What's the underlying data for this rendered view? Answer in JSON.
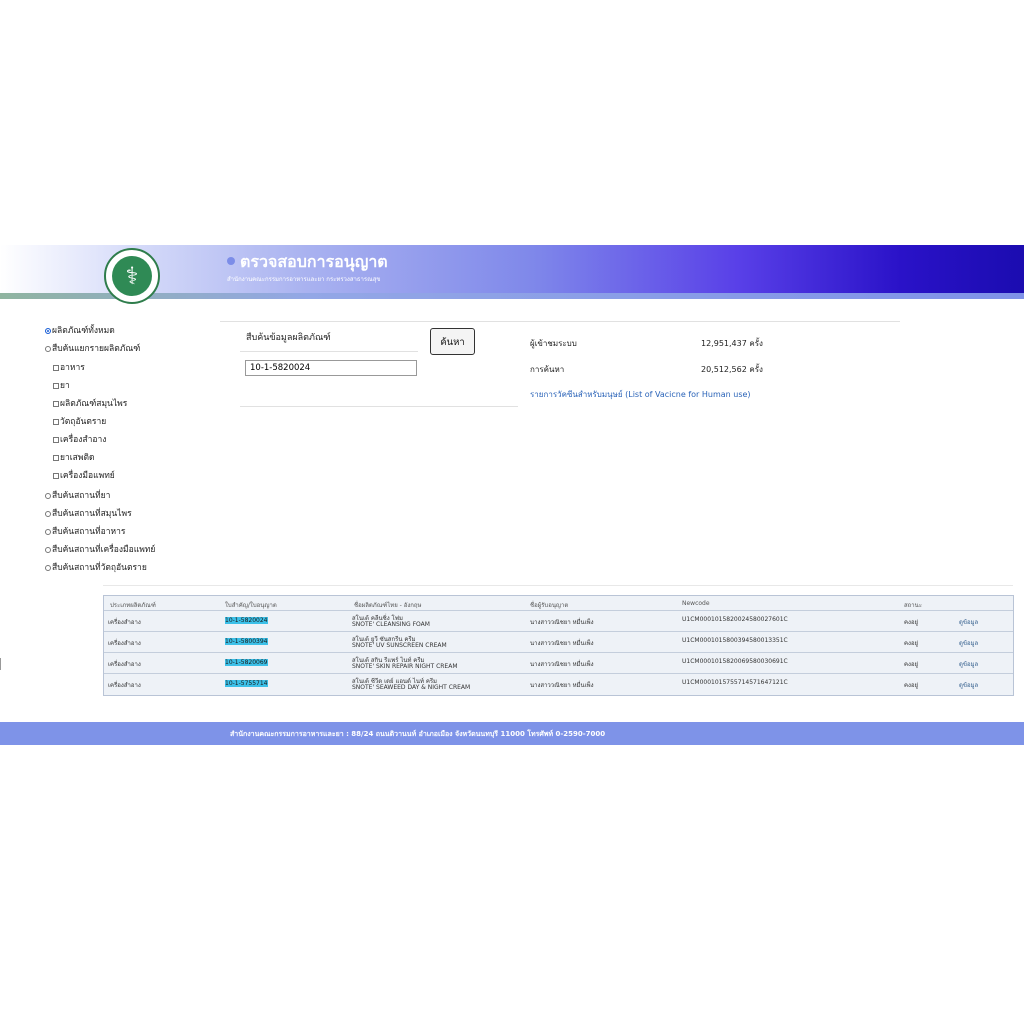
{
  "header": {
    "title": "ตรวจสอบการอนุญาต",
    "subtitle": "สำนักงานคณะกรรมการอาหารและยา กระทรวงสาธารณสุข"
  },
  "sidebar": {
    "items": [
      {
        "label": "ผลิตภัณฑ์ทั้งหมด",
        "type": "radio",
        "checked": true
      },
      {
        "label": "สืบค้นแยกรายผลิตภัณฑ์",
        "type": "radio",
        "checked": false
      },
      {
        "label": "อาหาร",
        "type": "checkbox",
        "checked": false
      },
      {
        "label": "ยา",
        "type": "checkbox",
        "checked": false
      },
      {
        "label": "ผลิตภัณฑ์สมุนไพร",
        "type": "checkbox",
        "checked": false
      },
      {
        "label": "วัตถุอันตราย",
        "type": "checkbox",
        "checked": false
      },
      {
        "label": "เครื่องสำอาง",
        "type": "checkbox",
        "checked": false
      },
      {
        "label": "ยาเสพติด",
        "type": "checkbox",
        "checked": false
      },
      {
        "label": "เครื่องมือแพทย์",
        "type": "checkbox",
        "checked": false
      },
      {
        "label": "สืบค้นสถานที่ยา",
        "type": "radio",
        "checked": false
      },
      {
        "label": "สืบค้นสถานที่สมุนไพร",
        "type": "radio",
        "checked": false
      },
      {
        "label": "สืบค้นสถานที่อาหาร",
        "type": "radio",
        "checked": false
      },
      {
        "label": "สืบค้นสถานที่เครื่องมือแพทย์",
        "type": "radio",
        "checked": false
      },
      {
        "label": "สืบค้นสถานที่วัตถุอันตราย",
        "type": "radio",
        "checked": false
      }
    ]
  },
  "search": {
    "label": "สืบค้นข้อมูลผลิตภัณฑ์",
    "value": "10-1-5820024",
    "button_label": "ค้นหา"
  },
  "stats": {
    "visitors_label": "ผู้เข้าชมระบบ",
    "visitors_value": "12,951,437 ครั้ง",
    "searches_label": "การค้นหา",
    "searches_value": "20,512,562 ครั้ง",
    "vaccine_link": "รายการวัคซีนสำหรับมนุษย์ (List of Vacicne for Human use)"
  },
  "table": {
    "headers": [
      "ประเภทผลิตภัณฑ์",
      "ใบสำคัญ/ใบอนุญาต",
      "ชื่อผลิตภัณฑ์ไทย - อังกฤษ",
      "ชื่อผู้รับอนุญาต",
      "Newcode",
      "สถานะ"
    ],
    "rows": [
      {
        "type": "เครื่องสำอาง",
        "license": "10-1-5820024",
        "name_th": "สโนเต้ คลีนซิ่ง โฟม",
        "name_en": "SNOTE' CLEANSING FOAM",
        "holder": "นางสาววณิชยา หมื่นเพ็ง",
        "newcode": "U1CM0001015820024580027601C",
        "status": "คงอยู่",
        "detail": "ดูข้อมูล"
      },
      {
        "type": "เครื่องสำอาง",
        "license": "10-1-5800394",
        "name_th": "สโนเต้ ยูวี ซันสกรีน ครีม",
        "name_en": "SNOTE' UV SUNSCREEN CREAM",
        "holder": "นางสาววณิชยา หมื่นเพ็ง",
        "newcode": "U1CM0001015800394580013351C",
        "status": "คงอยู่",
        "detail": "ดูข้อมูล"
      },
      {
        "type": "เครื่องสำอาง",
        "license": "10-1-5820069",
        "name_th": "สโนเต้ สกิน รีแพร์ ไนท์ ครีม",
        "name_en": "SNOTE' SKIN REPAIR NIGHT CREAM",
        "holder": "นางสาววณิชยา หมื่นเพ็ง",
        "newcode": "U1CM0001015820069580030691C",
        "status": "คงอยู่",
        "detail": "ดูข้อมูล"
      },
      {
        "type": "เครื่องสำอาง",
        "license": "10-1-5755714",
        "name_th": "สโนเต้ ซีวีด เดย์ แอนด์ ไนท์ ครีม",
        "name_en": "SNOTE' SEAWEED DAY & NIGHT CREAM",
        "holder": "นางสาววณิชยา หมื่นเพ็ง",
        "newcode": "U1CM0001015755714571647121C",
        "status": "คงอยู่",
        "detail": "ดูข้อมูล"
      }
    ]
  },
  "footer": {
    "text": "สำนักงานคณะกรรมการอาหารและยา : 88/24 ถนนติวานนท์ อำเภอเมือง จังหวัดนนทบุรี 11000 โทรศัพท์ 0-2590-7000"
  },
  "colors": {
    "header_end": "#1b0cb0",
    "footer": "#7e93e8",
    "license_highlight": "#3cc0e8",
    "link": "#2a63b8"
  }
}
